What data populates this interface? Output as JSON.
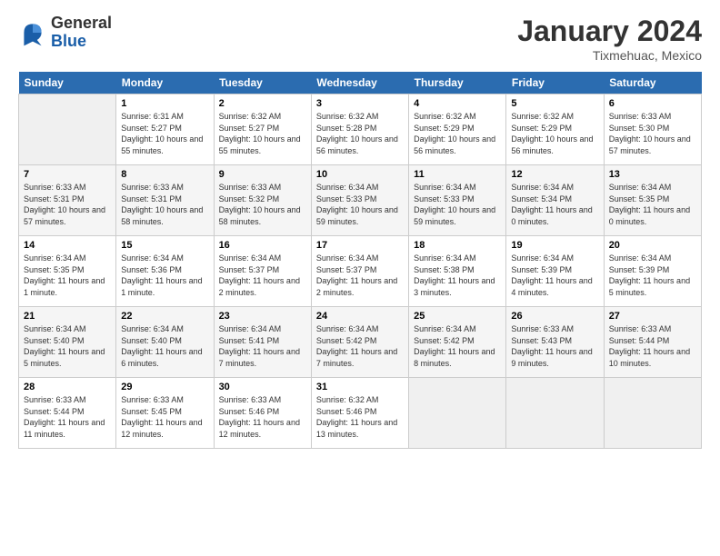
{
  "header": {
    "logo_line1": "General",
    "logo_line2": "Blue",
    "title": "January 2024",
    "location": "Tixmehuac, Mexico"
  },
  "days_of_week": [
    "Sunday",
    "Monday",
    "Tuesday",
    "Wednesday",
    "Thursday",
    "Friday",
    "Saturday"
  ],
  "weeks": [
    [
      {
        "num": "",
        "sunrise": "",
        "sunset": "",
        "daylight": "",
        "empty": true
      },
      {
        "num": "1",
        "sunrise": "Sunrise: 6:31 AM",
        "sunset": "Sunset: 5:27 PM",
        "daylight": "Daylight: 10 hours and 55 minutes."
      },
      {
        "num": "2",
        "sunrise": "Sunrise: 6:32 AM",
        "sunset": "Sunset: 5:27 PM",
        "daylight": "Daylight: 10 hours and 55 minutes."
      },
      {
        "num": "3",
        "sunrise": "Sunrise: 6:32 AM",
        "sunset": "Sunset: 5:28 PM",
        "daylight": "Daylight: 10 hours and 56 minutes."
      },
      {
        "num": "4",
        "sunrise": "Sunrise: 6:32 AM",
        "sunset": "Sunset: 5:29 PM",
        "daylight": "Daylight: 10 hours and 56 minutes."
      },
      {
        "num": "5",
        "sunrise": "Sunrise: 6:32 AM",
        "sunset": "Sunset: 5:29 PM",
        "daylight": "Daylight: 10 hours and 56 minutes."
      },
      {
        "num": "6",
        "sunrise": "Sunrise: 6:33 AM",
        "sunset": "Sunset: 5:30 PM",
        "daylight": "Daylight: 10 hours and 57 minutes."
      }
    ],
    [
      {
        "num": "7",
        "sunrise": "Sunrise: 6:33 AM",
        "sunset": "Sunset: 5:31 PM",
        "daylight": "Daylight: 10 hours and 57 minutes."
      },
      {
        "num": "8",
        "sunrise": "Sunrise: 6:33 AM",
        "sunset": "Sunset: 5:31 PM",
        "daylight": "Daylight: 10 hours and 58 minutes."
      },
      {
        "num": "9",
        "sunrise": "Sunrise: 6:33 AM",
        "sunset": "Sunset: 5:32 PM",
        "daylight": "Daylight: 10 hours and 58 minutes."
      },
      {
        "num": "10",
        "sunrise": "Sunrise: 6:34 AM",
        "sunset": "Sunset: 5:33 PM",
        "daylight": "Daylight: 10 hours and 59 minutes."
      },
      {
        "num": "11",
        "sunrise": "Sunrise: 6:34 AM",
        "sunset": "Sunset: 5:33 PM",
        "daylight": "Daylight: 10 hours and 59 minutes."
      },
      {
        "num": "12",
        "sunrise": "Sunrise: 6:34 AM",
        "sunset": "Sunset: 5:34 PM",
        "daylight": "Daylight: 11 hours and 0 minutes."
      },
      {
        "num": "13",
        "sunrise": "Sunrise: 6:34 AM",
        "sunset": "Sunset: 5:35 PM",
        "daylight": "Daylight: 11 hours and 0 minutes."
      }
    ],
    [
      {
        "num": "14",
        "sunrise": "Sunrise: 6:34 AM",
        "sunset": "Sunset: 5:35 PM",
        "daylight": "Daylight: 11 hours and 1 minute."
      },
      {
        "num": "15",
        "sunrise": "Sunrise: 6:34 AM",
        "sunset": "Sunset: 5:36 PM",
        "daylight": "Daylight: 11 hours and 1 minute."
      },
      {
        "num": "16",
        "sunrise": "Sunrise: 6:34 AM",
        "sunset": "Sunset: 5:37 PM",
        "daylight": "Daylight: 11 hours and 2 minutes."
      },
      {
        "num": "17",
        "sunrise": "Sunrise: 6:34 AM",
        "sunset": "Sunset: 5:37 PM",
        "daylight": "Daylight: 11 hours and 2 minutes."
      },
      {
        "num": "18",
        "sunrise": "Sunrise: 6:34 AM",
        "sunset": "Sunset: 5:38 PM",
        "daylight": "Daylight: 11 hours and 3 minutes."
      },
      {
        "num": "19",
        "sunrise": "Sunrise: 6:34 AM",
        "sunset": "Sunset: 5:39 PM",
        "daylight": "Daylight: 11 hours and 4 minutes."
      },
      {
        "num": "20",
        "sunrise": "Sunrise: 6:34 AM",
        "sunset": "Sunset: 5:39 PM",
        "daylight": "Daylight: 11 hours and 5 minutes."
      }
    ],
    [
      {
        "num": "21",
        "sunrise": "Sunrise: 6:34 AM",
        "sunset": "Sunset: 5:40 PM",
        "daylight": "Daylight: 11 hours and 5 minutes."
      },
      {
        "num": "22",
        "sunrise": "Sunrise: 6:34 AM",
        "sunset": "Sunset: 5:40 PM",
        "daylight": "Daylight: 11 hours and 6 minutes."
      },
      {
        "num": "23",
        "sunrise": "Sunrise: 6:34 AM",
        "sunset": "Sunset: 5:41 PM",
        "daylight": "Daylight: 11 hours and 7 minutes."
      },
      {
        "num": "24",
        "sunrise": "Sunrise: 6:34 AM",
        "sunset": "Sunset: 5:42 PM",
        "daylight": "Daylight: 11 hours and 7 minutes."
      },
      {
        "num": "25",
        "sunrise": "Sunrise: 6:34 AM",
        "sunset": "Sunset: 5:42 PM",
        "daylight": "Daylight: 11 hours and 8 minutes."
      },
      {
        "num": "26",
        "sunrise": "Sunrise: 6:33 AM",
        "sunset": "Sunset: 5:43 PM",
        "daylight": "Daylight: 11 hours and 9 minutes."
      },
      {
        "num": "27",
        "sunrise": "Sunrise: 6:33 AM",
        "sunset": "Sunset: 5:44 PM",
        "daylight": "Daylight: 11 hours and 10 minutes."
      }
    ],
    [
      {
        "num": "28",
        "sunrise": "Sunrise: 6:33 AM",
        "sunset": "Sunset: 5:44 PM",
        "daylight": "Daylight: 11 hours and 11 minutes."
      },
      {
        "num": "29",
        "sunrise": "Sunrise: 6:33 AM",
        "sunset": "Sunset: 5:45 PM",
        "daylight": "Daylight: 11 hours and 12 minutes."
      },
      {
        "num": "30",
        "sunrise": "Sunrise: 6:33 AM",
        "sunset": "Sunset: 5:46 PM",
        "daylight": "Daylight: 11 hours and 12 minutes."
      },
      {
        "num": "31",
        "sunrise": "Sunrise: 6:32 AM",
        "sunset": "Sunset: 5:46 PM",
        "daylight": "Daylight: 11 hours and 13 minutes."
      },
      {
        "num": "",
        "sunrise": "",
        "sunset": "",
        "daylight": "",
        "empty": true
      },
      {
        "num": "",
        "sunrise": "",
        "sunset": "",
        "daylight": "",
        "empty": true
      },
      {
        "num": "",
        "sunrise": "",
        "sunset": "",
        "daylight": "",
        "empty": true
      }
    ]
  ]
}
